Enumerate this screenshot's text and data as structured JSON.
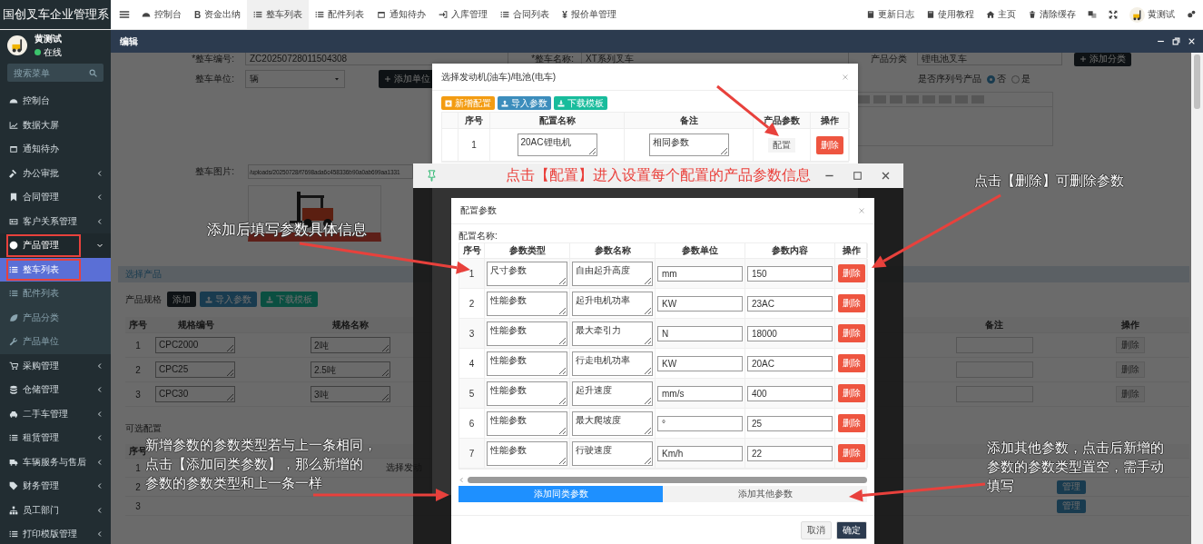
{
  "header": {
    "brand": "国创叉车企业管理系",
    "nav": [
      {
        "label": "控制台",
        "selected": false
      },
      {
        "glyph": "B",
        "label": "资金出纳",
        "selected": false
      },
      {
        "label": "整车列表",
        "selected": true
      },
      {
        "label": "配件列表",
        "selected": false
      },
      {
        "label": "通知待办",
        "selected": false
      },
      {
        "label": "入库管理",
        "selected": false
      },
      {
        "label": "合同列表",
        "selected": false
      },
      {
        "glyph": "¥",
        "label": "报价单管理",
        "selected": false
      }
    ],
    "tools": [
      {
        "label": "更新日志"
      },
      {
        "label": "使用教程"
      },
      {
        "label": "主页"
      },
      {
        "label": "清除缓存"
      },
      {
        "label": "黄测试"
      }
    ]
  },
  "user": {
    "name": "黄测试",
    "status": "在线"
  },
  "sidebar": {
    "search_placeholder": "搜索菜单",
    "items": [
      {
        "label": "控制台",
        "selected": false,
        "highlighted": false
      },
      {
        "label": "数据大屏",
        "selected": false,
        "highlighted": false
      },
      {
        "label": "通知待办",
        "selected": false,
        "highlighted": false
      },
      {
        "label": "办公审批",
        "selected": false,
        "highlighted": false,
        "expanded": false
      },
      {
        "label": "合同管理",
        "selected": false,
        "highlighted": false,
        "expanded": false
      },
      {
        "label": "客户关系管理",
        "selected": false,
        "highlighted": false,
        "expanded": false
      },
      {
        "label": "产品管理",
        "selected": false,
        "highlighted": true,
        "expanded": true,
        "children": [
          {
            "label": "整车列表",
            "selected": true,
            "highlighted": true
          },
          {
            "label": "配件列表",
            "selected": false,
            "highlighted": false
          },
          {
            "label": "产品分类",
            "selected": false,
            "highlighted": false
          },
          {
            "label": "产品单位",
            "selected": false,
            "highlighted": false
          }
        ]
      },
      {
        "label": "采购管理",
        "selected": false,
        "highlighted": false,
        "expanded": false
      },
      {
        "label": "仓储管理",
        "selected": false,
        "highlighted": false,
        "expanded": false
      },
      {
        "label": "二手车管理",
        "selected": false,
        "highlighted": false,
        "expanded": false
      },
      {
        "label": "租赁管理",
        "selected": false,
        "highlighted": false,
        "expanded": false
      },
      {
        "label": "车辆服务与售后",
        "selected": false,
        "highlighted": false,
        "expanded": false
      },
      {
        "label": "财务管理",
        "selected": false,
        "highlighted": false,
        "expanded": false
      },
      {
        "label": "员工部门",
        "selected": false,
        "highlighted": false,
        "expanded": false
      },
      {
        "label": "打印模版管理",
        "selected": false,
        "highlighted": false,
        "expanded": false
      }
    ]
  },
  "tab": {
    "title": "编辑"
  },
  "form": {
    "fields": [
      {
        "label": "*整车编号:",
        "value": "ZC20250728011504308"
      },
      {
        "label": "*整车名称:",
        "value": "XT系列叉车"
      },
      {
        "label": "产品分类",
        "value": "锂电池叉车"
      }
    ],
    "add_category": "添加分类",
    "unit": {
      "label": "整车单位:",
      "value": "辆"
    },
    "add_unit": "添加单位",
    "serial": {
      "label": "是否序列号产品",
      "options": [
        {
          "label": "否",
          "selected": true
        },
        {
          "label": "是",
          "selected": false
        }
      ]
    },
    "image": {
      "label": "整车图片:",
      "path": "/uploads/20250728/f7698ada6c458336b90a0ab699aa1331"
    },
    "section": "选择产品",
    "spec": {
      "label": "产品规格",
      "buttons": [
        {
          "kind": "dark",
          "label": "添加"
        },
        {
          "kind": "blue",
          "label": "导入参数"
        },
        {
          "kind": "green",
          "label": "下载模板"
        }
      ],
      "columns": [
        "序号",
        "规格编号",
        "规格名称",
        "备注",
        "操作"
      ],
      "rows": [
        {
          "index": "1",
          "code": "CPC2000",
          "name": "2吨",
          "action": "删除"
        },
        {
          "index": "2",
          "code": "CPC25",
          "name": "2.5吨",
          "action": "删除"
        },
        {
          "index": "3",
          "code": "CPC30",
          "name": "3吨",
          "action": "删除"
        }
      ]
    },
    "options": {
      "label": "可选配置",
      "columns": [
        "序号"
      ],
      "rows": [
        {
          "index": "1",
          "engine": "选择发动"
        },
        {
          "index": "2",
          "action": "管理"
        },
        {
          "index": "3",
          "action": "管理"
        }
      ]
    }
  },
  "engine_dialog": {
    "title": "选择发动机(油车)/电池(电车)",
    "buttons": [
      {
        "kind": "orange",
        "label": "新增配置"
      },
      {
        "kind": "blue",
        "label": "导入参数"
      },
      {
        "kind": "green",
        "label": "下载模板"
      }
    ],
    "columns": [
      "序号",
      "配置名称",
      "备注",
      "产品参数",
      "操作"
    ],
    "rows": [
      {
        "index": "1",
        "name": "20AC锂电机",
        "note": "相同参数",
        "config": "配置",
        "action": "删除"
      }
    ]
  },
  "tutorial_window": {
    "title": "点击【配置】进入设置每个配置的产品参数信息"
  },
  "param_dialog": {
    "title": "配置参数",
    "config_label": "配置名称:",
    "columns": [
      "序号",
      "参数类型",
      "参数名称",
      "参数单位",
      "参数内容",
      "操作"
    ],
    "rows": [
      {
        "index": "1",
        "type": "尺寸参数",
        "name": "自由起升高度",
        "unit": "mm",
        "content": "150",
        "action": "删除"
      },
      {
        "index": "2",
        "type": "性能参数",
        "name": "起升电机功率",
        "unit": "KW",
        "content": "23AC",
        "action": "删除"
      },
      {
        "index": "3",
        "type": "性能参数",
        "name": "最大牵引力",
        "unit": "N",
        "content": "18000",
        "action": "删除"
      },
      {
        "index": "4",
        "type": "性能参数",
        "name": "行走电机功率",
        "unit": "KW",
        "content": "20AC",
        "action": "删除"
      },
      {
        "index": "5",
        "type": "性能参数",
        "name": "起升速度",
        "unit": "mm/s",
        "content": "400",
        "action": "删除"
      },
      {
        "index": "6",
        "type": "性能参数",
        "name": "最大爬坡度",
        "unit": "°",
        "content": "25",
        "action": "删除"
      },
      {
        "index": "7",
        "type": "性能参数",
        "name": "行驶速度",
        "unit": "Km/h",
        "content": "22",
        "action": "删除"
      }
    ],
    "actions": [
      {
        "kind": "primary",
        "label": "添加同类参数"
      },
      {
        "kind": "default",
        "label": "添加其他参数"
      }
    ],
    "footer": [
      {
        "kind": "default",
        "label": "取消"
      },
      {
        "kind": "navy",
        "label": "确定"
      }
    ]
  },
  "annotations": [
    {
      "lines": [
        "添加后填写参数具体信息"
      ]
    },
    {
      "lines": [
        "点击【删除】可删除参数"
      ]
    },
    {
      "lines": [
        "新增参数的参数类型若与上一条相同，",
        "点击【添加同类参数】，那么新增的",
        "参数的参数类型和上一条一样"
      ]
    },
    {
      "lines": [
        "添加其他参数，点击后新增的",
        "参数的参数类型置空，需手动",
        "填写"
      ]
    }
  ]
}
